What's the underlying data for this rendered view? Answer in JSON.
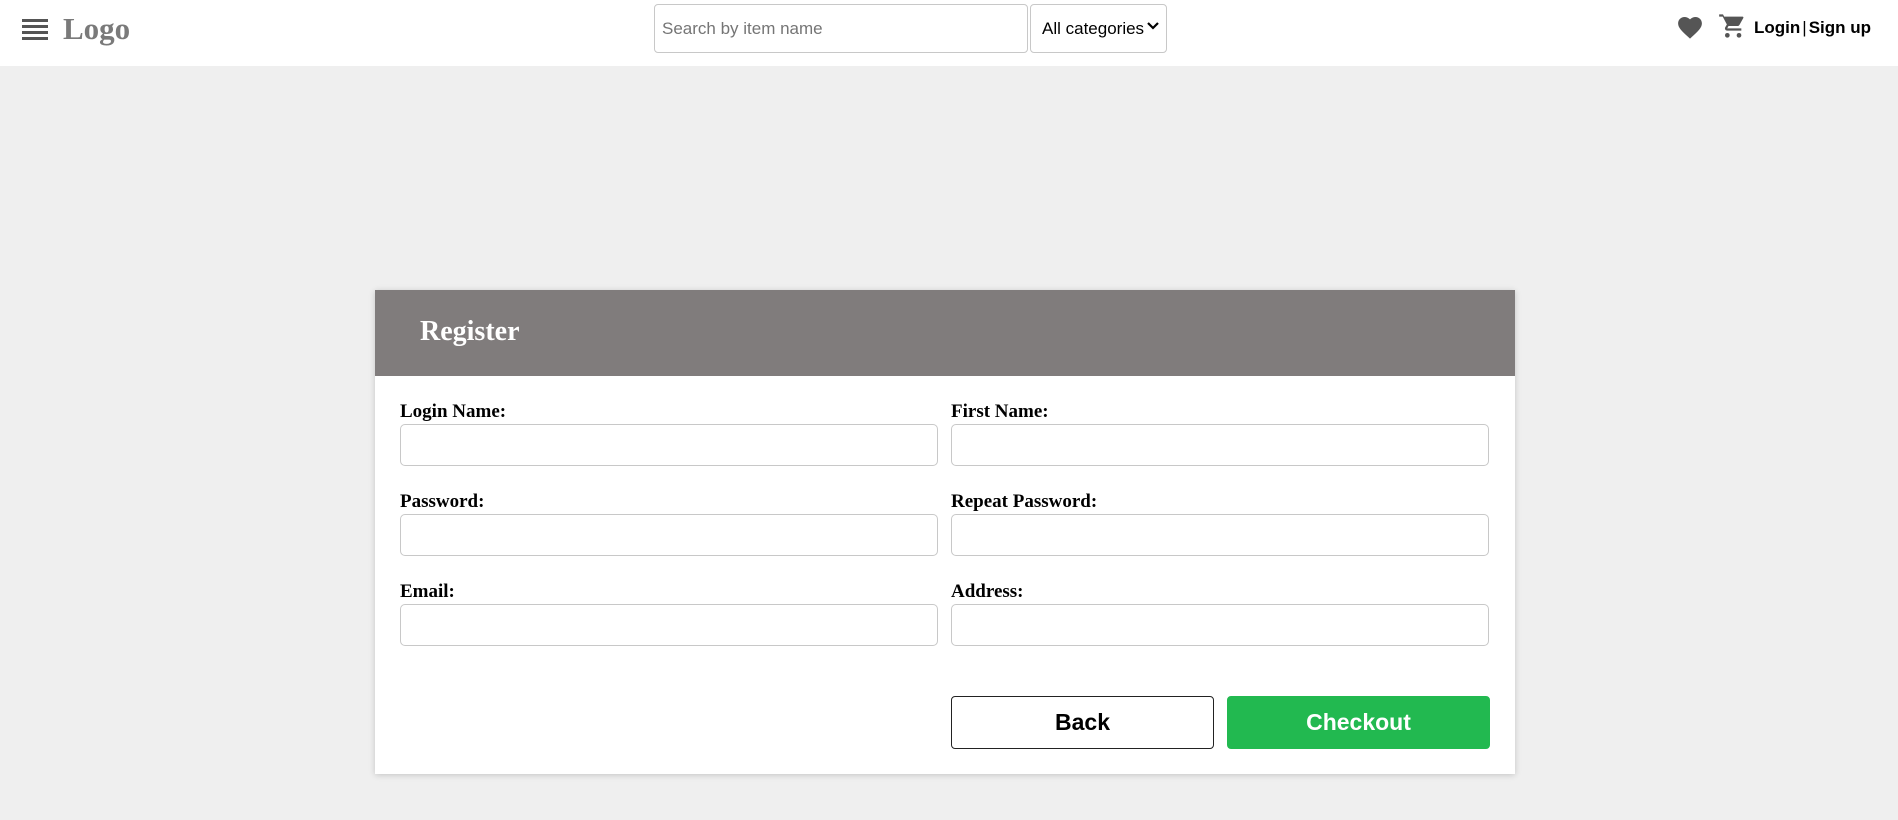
{
  "header": {
    "logo": "Logo",
    "search_placeholder": "Search by item name",
    "search_value": "",
    "category_selected": "All categories",
    "login_label": "Login",
    "separator": "|",
    "signup_label": "Sign up"
  },
  "form": {
    "title": "Register",
    "fields": [
      {
        "label": "Login Name:",
        "value": ""
      },
      {
        "label": "First Name:",
        "value": ""
      },
      {
        "label": "Password:",
        "value": ""
      },
      {
        "label": "Repeat Password:",
        "value": ""
      },
      {
        "label": "Email:",
        "value": ""
      },
      {
        "label": "Address:",
        "value": ""
      }
    ],
    "back_label": "Back",
    "checkout_label": "Checkout"
  },
  "colors": {
    "page_bg": "#efefef",
    "header_bar": "#807c7c",
    "checkout_green": "#22b950",
    "logo_gray": "#7a7a7a"
  },
  "icons": [
    "menu-icon",
    "heart-icon",
    "cart-icon",
    "chevron-down-icon"
  ]
}
